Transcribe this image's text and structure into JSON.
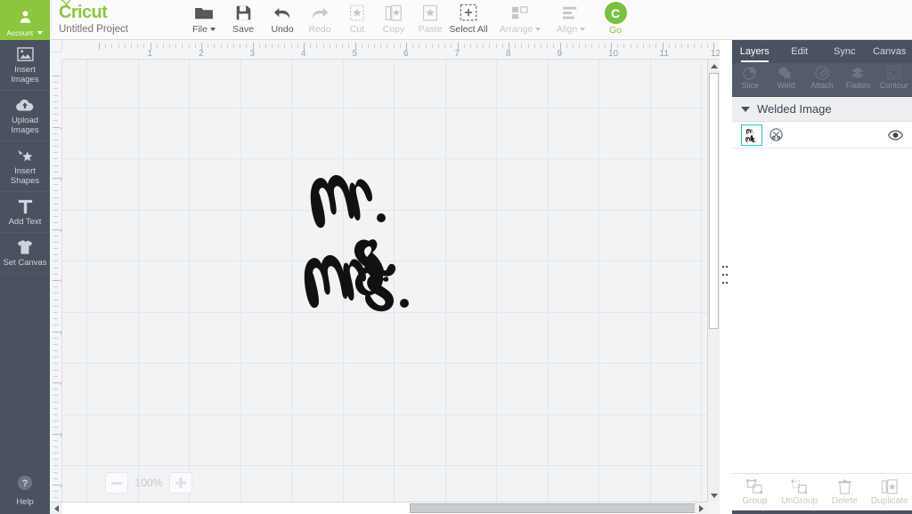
{
  "header": {
    "account": {
      "label": "Account",
      "icon": "user-icon",
      "caret": true
    },
    "brand": "Cricut",
    "project_title": "Untitled Project",
    "accent_green": "#8cc63e",
    "tools": [
      {
        "label": "File",
        "icon": "folder-icon",
        "disabled": false,
        "caret": true
      },
      {
        "label": "Save",
        "icon": "floppy-disk-icon",
        "disabled": false,
        "caret": false
      },
      {
        "label": "Undo",
        "icon": "undo-arrow-icon",
        "disabled": false,
        "caret": false
      },
      {
        "label": "Redo",
        "icon": "redo-arrow-icon",
        "disabled": true,
        "caret": false
      },
      {
        "label": "Cut",
        "icon": "cut-icon",
        "disabled": true,
        "caret": false
      },
      {
        "label": "Copy",
        "icon": "copy-icon",
        "disabled": true,
        "caret": false
      },
      {
        "label": "Paste",
        "icon": "paste-icon",
        "disabled": true,
        "caret": false
      },
      {
        "label": "Select All",
        "icon": "select-all-icon",
        "disabled": false,
        "caret": false
      },
      {
        "label": "Arrange",
        "icon": "arrange-icon",
        "disabled": true,
        "caret": true
      },
      {
        "label": "Align",
        "icon": "align-icon",
        "disabled": true,
        "caret": true
      }
    ],
    "go": {
      "label": "Go",
      "icon": "cricut-c-icon",
      "color": "#79c043"
    }
  },
  "sidebar": {
    "items": [
      {
        "label": "Insert\nImages",
        "line1": "Insert",
        "line2": "Images",
        "icon": "image-frame-icon"
      },
      {
        "label": "Upload\nImages",
        "line1": "Upload",
        "line2": "Images",
        "icon": "cloud-upload-icon"
      },
      {
        "label": "Insert\nShapes",
        "line1": "Insert",
        "line2": "Shapes",
        "icon": "cursor-star-icon"
      },
      {
        "label": "Add Text",
        "line1": "Add Text",
        "line2": "",
        "icon": "text-t-icon"
      },
      {
        "label": "Set Canvas",
        "line1": "Set Canvas",
        "line2": "",
        "icon": "tshirt-icon"
      }
    ],
    "help": {
      "label": "Help",
      "icon": "question-circle-icon"
    }
  },
  "canvas": {
    "ruler_h_labels": [
      "1",
      "2",
      "3",
      "4",
      "5",
      "6",
      "7",
      "8",
      "9",
      "10",
      "11",
      "12"
    ],
    "ruler_v_labels": [
      "1",
      "2",
      "3",
      "4",
      "5",
      "6",
      "7",
      "8",
      "9"
    ],
    "artwork_name": "Mr. & Mrs.",
    "artwork_color": "#111111",
    "zoom": {
      "value": "100%",
      "minus": "−",
      "plus": "+"
    },
    "scrollbars": {
      "vertical": "vertical-scrollbar",
      "horizontal": "horizontal-scrollbar"
    }
  },
  "panel": {
    "tabs": [
      {
        "label": "Layers",
        "active": true
      },
      {
        "label": "Edit",
        "active": false
      },
      {
        "label": "Sync",
        "active": false
      },
      {
        "label": "Canvas",
        "active": false
      }
    ],
    "operations": [
      {
        "label": "Slice",
        "icon": "slice-icon",
        "disabled": true
      },
      {
        "label": "Weld",
        "icon": "weld-icon",
        "disabled": true
      },
      {
        "label": "Attach",
        "icon": "attach-icon",
        "disabled": true
      },
      {
        "label": "Flatten",
        "icon": "flatten-icon",
        "disabled": true
      },
      {
        "label": "Contour",
        "icon": "contour-icon",
        "disabled": true
      }
    ],
    "group": {
      "title": "Welded Image",
      "expanded": true
    },
    "layer": {
      "thumbnail_label": "Mr. & Mrs.",
      "thumb_border_color": "#2fc3c9",
      "cut_icon": "cut-circle-icon",
      "visibility_icon": "eye-icon"
    },
    "footer": [
      {
        "label": "Group",
        "icon": "group-icon",
        "disabled": true
      },
      {
        "label": "UnGroup",
        "icon": "ungroup-icon",
        "disabled": true
      },
      {
        "label": "Delete",
        "icon": "trash-icon",
        "disabled": true
      },
      {
        "label": "Duplicate",
        "icon": "duplicate-icon",
        "disabled": true
      }
    ]
  }
}
